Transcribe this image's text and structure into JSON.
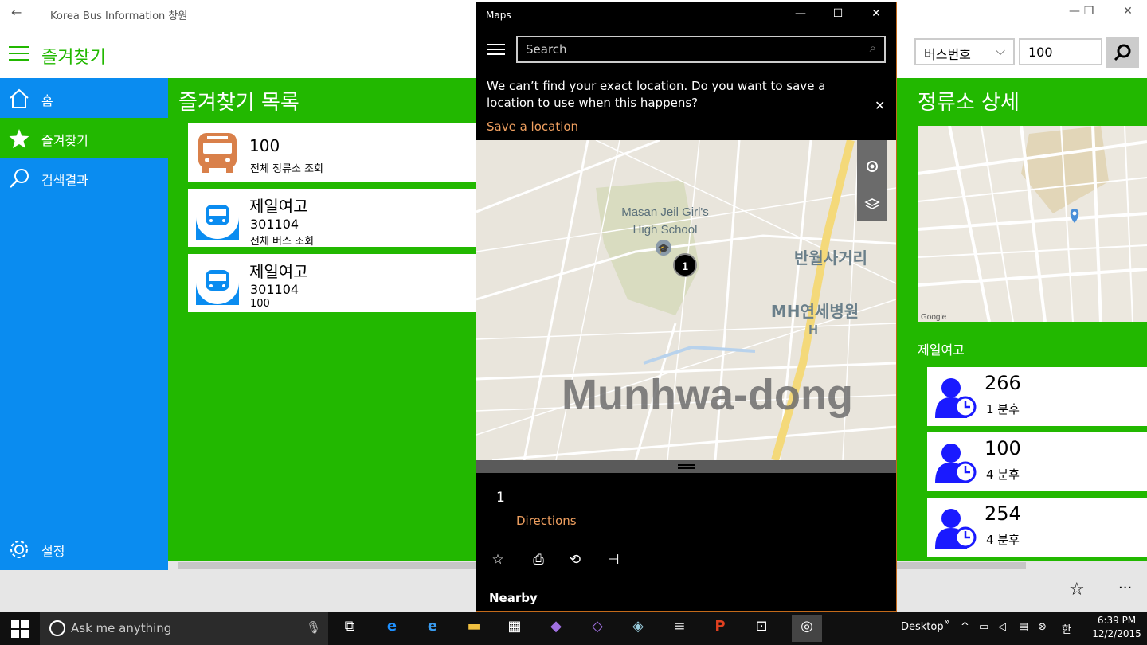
{
  "app": {
    "window_title": "Korea Bus Information 창원",
    "header_title": "즐겨찾기",
    "search_type": "버스번호",
    "search_value": "100"
  },
  "nav": {
    "items": [
      {
        "label": "홈",
        "icon": "home-icon"
      },
      {
        "label": "즐겨찾기",
        "icon": "star-icon"
      },
      {
        "label": "검색결과",
        "icon": "search-icon"
      }
    ],
    "settings_label": "설정"
  },
  "favorites": {
    "title": "즐겨찾기 목록",
    "items": [
      {
        "name": "100",
        "line2": "전체 정류소 조회",
        "line3": "",
        "type": "bus"
      },
      {
        "name": "제일여고",
        "line2": "301104",
        "line3": "전체 버스 조회",
        "type": "stop"
      },
      {
        "name": "제일여고",
        "line2": "301104",
        "line3": "100",
        "type": "stop"
      }
    ]
  },
  "stop_detail": {
    "title": "정류소 상세",
    "stop_name": "제일여고",
    "arrivals": [
      {
        "bus": "266",
        "time": "1 분후"
      },
      {
        "bus": "100",
        "time": "4 분후"
      },
      {
        "bus": "254",
        "time": "4 분후"
      }
    ]
  },
  "maps": {
    "window_title": "Maps",
    "search_placeholder": "Search",
    "notice": "We can’t find your exact location. Do you want to save a location to use when this happens?",
    "save_location": "Save a location",
    "map_labels": {
      "school": "Masan Jeil Girl's High School",
      "school_line1": "Masan Jeil Girl's",
      "school_line2": "High School",
      "intersection": "반월사거리",
      "hospital": "MH연세병원",
      "hospital_marker": "H",
      "district": "Munhwa-dong",
      "pin": "1"
    },
    "result_number": "1",
    "directions": "Directions",
    "nearby": "Nearby"
  },
  "taskbar": {
    "search_placeholder": "Ask me anything",
    "desktop_label": "Desktop",
    "time": "6:39 PM",
    "date": "12/2/2015"
  },
  "colors": {
    "accent_green": "#22b800",
    "nav_blue": "#0a8cf0",
    "link_orange": "#f0a060",
    "person_blue": "#1a1aff"
  }
}
